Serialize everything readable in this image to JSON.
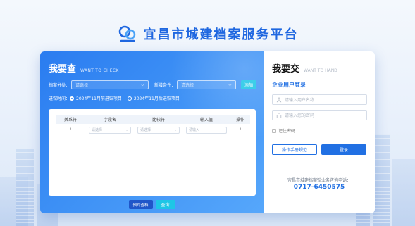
{
  "header": {
    "title": "宜昌市城建档案服务平台"
  },
  "query": {
    "title": "我要查",
    "subtitle": "WANT TO CHECK",
    "archive_label": "档案分类：",
    "archive_placeholder": "请选择",
    "condition_label": "新增条件：",
    "condition_placeholder": "请选择",
    "add_button": "添加",
    "time_label": "进馆时间：",
    "time_options": [
      {
        "label": "2024年11月前进馆项目",
        "selected": true
      },
      {
        "label": "2024年11月后进馆项目",
        "selected": false
      }
    ],
    "table": {
      "headers": [
        "关系符",
        "字段名",
        "比较符",
        "输入值",
        "操作"
      ],
      "rows": [
        {
          "relation": "/",
          "field": "请选择",
          "compare": "请选择",
          "value_placeholder": "请输入",
          "op": "/"
        }
      ]
    },
    "buttons": {
      "reserve": "预约查档",
      "query": "查询"
    }
  },
  "submit": {
    "title": "我要交",
    "subtitle": "WANT TO HAND",
    "login_title": "企业用户登录",
    "username_placeholder": "请输入用户名称",
    "password_placeholder": "请输入您的密码",
    "remember_label": "记住密码",
    "manual_button": "操作手册规范",
    "login_button": "登录",
    "contact_label": "宜昌市城建档案馆业务咨询电话：",
    "contact_phone": "0717-6450575"
  },
  "colors": {
    "brand": "#2170e3",
    "accent": "#1ec6e6",
    "panel_gradient_start": "#2a7cf0"
  }
}
